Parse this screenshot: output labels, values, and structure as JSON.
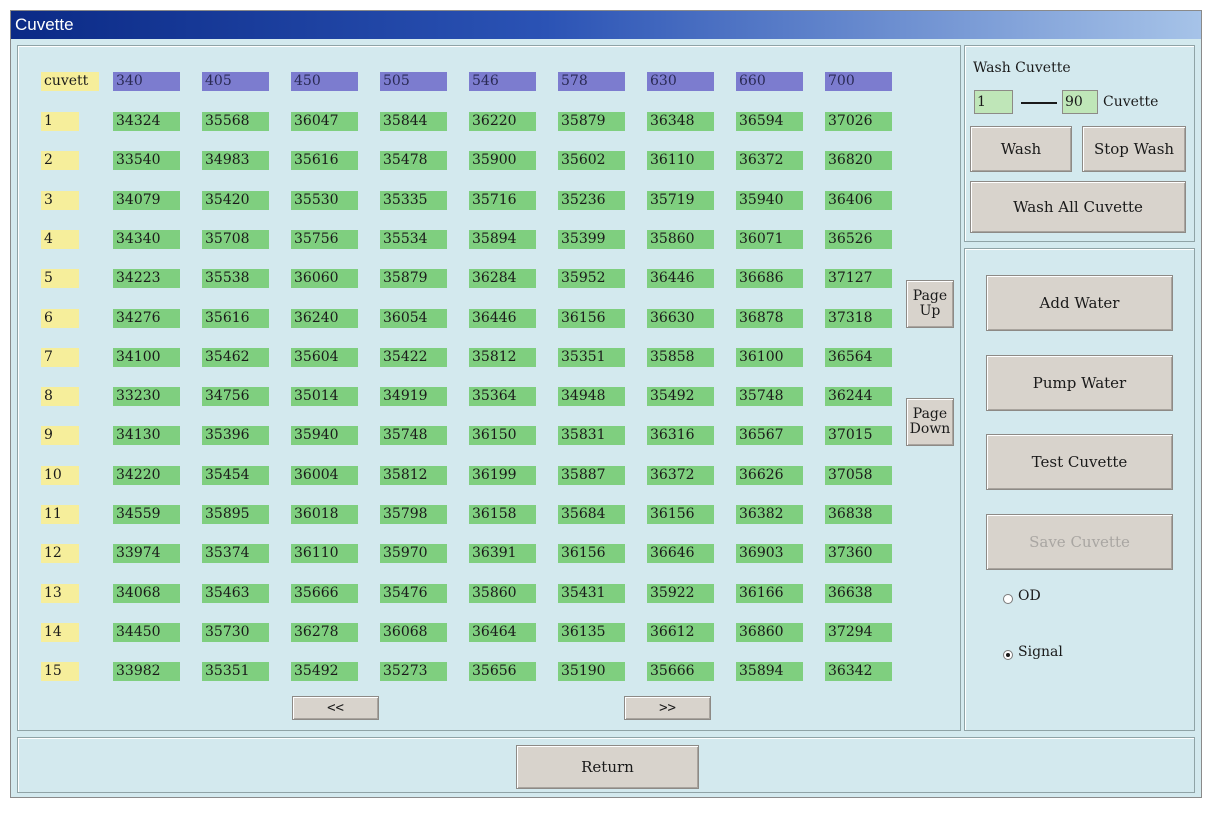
{
  "window": {
    "title": "Cuvette"
  },
  "grid": {
    "corner_label": "cuvett",
    "wavelengths": [
      "340",
      "405",
      "450",
      "505",
      "546",
      "578",
      "630",
      "660",
      "700"
    ],
    "rows": [
      {
        "cuvette": "1",
        "values": [
          "34324",
          "35568",
          "36047",
          "35844",
          "36220",
          "35879",
          "36348",
          "36594",
          "37026"
        ]
      },
      {
        "cuvette": "2",
        "values": [
          "33540",
          "34983",
          "35616",
          "35478",
          "35900",
          "35602",
          "36110",
          "36372",
          "36820"
        ]
      },
      {
        "cuvette": "3",
        "values": [
          "34079",
          "35420",
          "35530",
          "35335",
          "35716",
          "35236",
          "35719",
          "35940",
          "36406"
        ]
      },
      {
        "cuvette": "4",
        "values": [
          "34340",
          "35708",
          "35756",
          "35534",
          "35894",
          "35399",
          "35860",
          "36071",
          "36526"
        ]
      },
      {
        "cuvette": "5",
        "values": [
          "34223",
          "35538",
          "36060",
          "35879",
          "36284",
          "35952",
          "36446",
          "36686",
          "37127"
        ]
      },
      {
        "cuvette": "6",
        "values": [
          "34276",
          "35616",
          "36240",
          "36054",
          "36446",
          "36156",
          "36630",
          "36878",
          "37318"
        ]
      },
      {
        "cuvette": "7",
        "values": [
          "34100",
          "35462",
          "35604",
          "35422",
          "35812",
          "35351",
          "35858",
          "36100",
          "36564"
        ]
      },
      {
        "cuvette": "8",
        "values": [
          "33230",
          "34756",
          "35014",
          "34919",
          "35364",
          "34948",
          "35492",
          "35748",
          "36244"
        ]
      },
      {
        "cuvette": "9",
        "values": [
          "34130",
          "35396",
          "35940",
          "35748",
          "36150",
          "35831",
          "36316",
          "36567",
          "37015"
        ]
      },
      {
        "cuvette": "10",
        "values": [
          "34220",
          "35454",
          "36004",
          "35812",
          "36199",
          "35887",
          "36372",
          "36626",
          "37058"
        ]
      },
      {
        "cuvette": "11",
        "values": [
          "34559",
          "35895",
          "36018",
          "35798",
          "36158",
          "35684",
          "36156",
          "36382",
          "36838"
        ]
      },
      {
        "cuvette": "12",
        "values": [
          "33974",
          "35374",
          "36110",
          "35970",
          "36391",
          "36156",
          "36646",
          "36903",
          "37360"
        ]
      },
      {
        "cuvette": "13",
        "values": [
          "34068",
          "35463",
          "35666",
          "35476",
          "35860",
          "35431",
          "35922",
          "36166",
          "36638"
        ]
      },
      {
        "cuvette": "14",
        "values": [
          "34450",
          "35730",
          "36278",
          "36068",
          "36464",
          "36135",
          "36612",
          "36860",
          "37294"
        ]
      },
      {
        "cuvette": "15",
        "values": [
          "33982",
          "35351",
          "35492",
          "35273",
          "35656",
          "35190",
          "35666",
          "35894",
          "36342"
        ]
      }
    ],
    "prev_label": "<<",
    "next_label": ">>",
    "page_up_label": "Page\nUp",
    "page_down_label": "Page\nDown"
  },
  "wash": {
    "title": "Wash Cuvette",
    "from_value": "1",
    "to_value": "90",
    "unit_label": "Cuvette",
    "wash_label": "Wash",
    "stop_wash_label": "Stop Wash",
    "wash_all_label": "Wash All Cuvette"
  },
  "ops": {
    "add_water_label": "Add Water",
    "pump_water_label": "Pump Water",
    "test_cuvette_label": "Test Cuvette",
    "save_cuvette_label": "Save Cuvette",
    "save_cuvette_enabled": false,
    "mode_options": [
      "OD",
      "Signal"
    ],
    "mode_selected": "Signal"
  },
  "footer": {
    "return_label": "Return"
  },
  "colors": {
    "window_bg": "#d3e9ee",
    "header_wavelength": "#7c7ccf",
    "row_label": "#f6ee9b",
    "value_cell": "#7fcf7f",
    "field_bg": "#bfe6b8"
  }
}
